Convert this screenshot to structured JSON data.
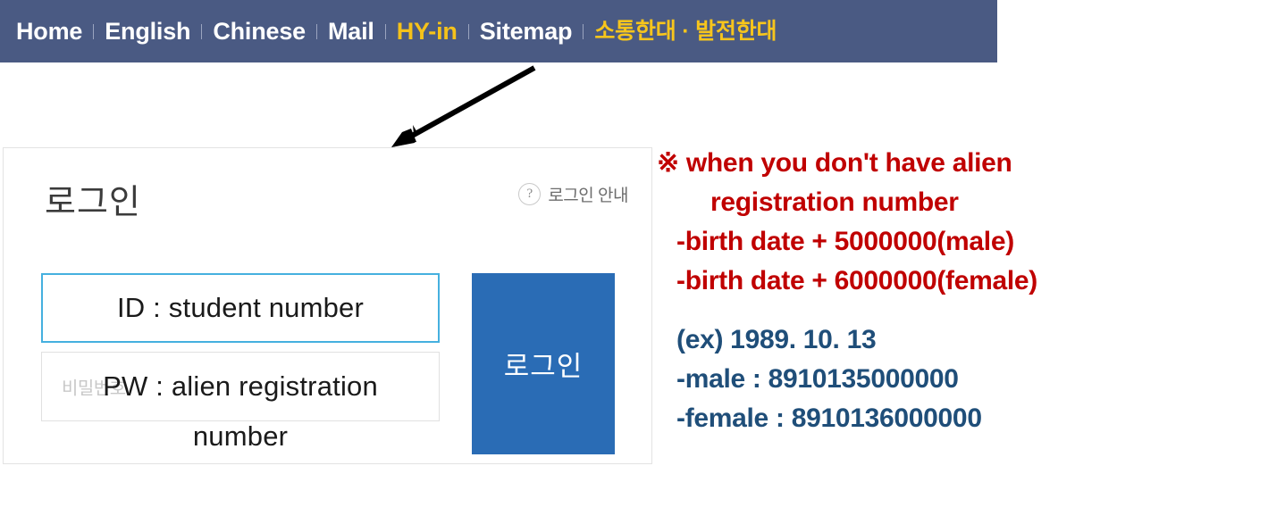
{
  "topnav": {
    "background_color": "#4a5a83",
    "accent_color": "#f5c21a",
    "items": [
      {
        "label": "Home",
        "style": "white"
      },
      {
        "label": "English",
        "style": "white"
      },
      {
        "label": "Chinese",
        "style": "white"
      },
      {
        "label": "Mail",
        "style": "white"
      },
      {
        "label": "HY-in",
        "style": "accent"
      },
      {
        "label": "Sitemap",
        "style": "white"
      },
      {
        "label": "소통한대 · 발전한대",
        "style": "accent-ko"
      }
    ]
  },
  "annotation": {
    "arrow_name": "pointer-arrow",
    "arrow_color": "#000000"
  },
  "login": {
    "heading": "로그인",
    "help_icon": "question-circle-icon",
    "help_label": "로그인 안내",
    "id_field": {
      "value": "ID : student number",
      "border_color": "#45b0df"
    },
    "pw_field": {
      "value": "PW : alien registration",
      "overflow_value": "number",
      "placeholder": "비밀번호",
      "border_color": "#e1e1e1"
    },
    "submit_label": "로그인",
    "submit_color": "#2a6cb5"
  },
  "notes": {
    "red_color": "#c00000",
    "blue_color": "#1f4e79",
    "red_lines": [
      {
        "text": "※ when you don't have alien",
        "indent": 0
      },
      {
        "text": "registration number",
        "indent": 1
      },
      {
        "text": "-birth date + 5000000(male)",
        "indent": 2
      },
      {
        "text": "-birth date + 6000000(female)",
        "indent": 2
      }
    ],
    "blue_lines": [
      {
        "text": "(ex)  1989. 10. 13"
      },
      {
        "text": "-male : 8910135000000"
      },
      {
        "text": "-female : 8910136000000"
      }
    ]
  }
}
